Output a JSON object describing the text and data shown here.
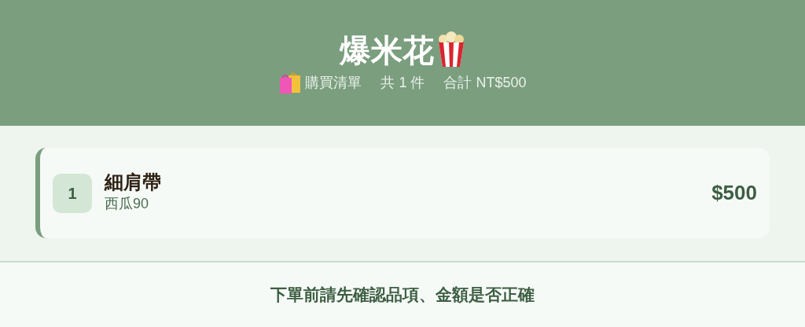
{
  "header": {
    "title": "爆米花",
    "subtitle": {
      "label": "購買清單",
      "count": "共 1 件",
      "total": "合計 NT$500"
    }
  },
  "items": [
    {
      "index": "1",
      "name": "細肩帶",
      "option": "西瓜90",
      "price": "$500"
    }
  ],
  "footer": {
    "note": "下單前請先確認品項、金額是否正確"
  }
}
